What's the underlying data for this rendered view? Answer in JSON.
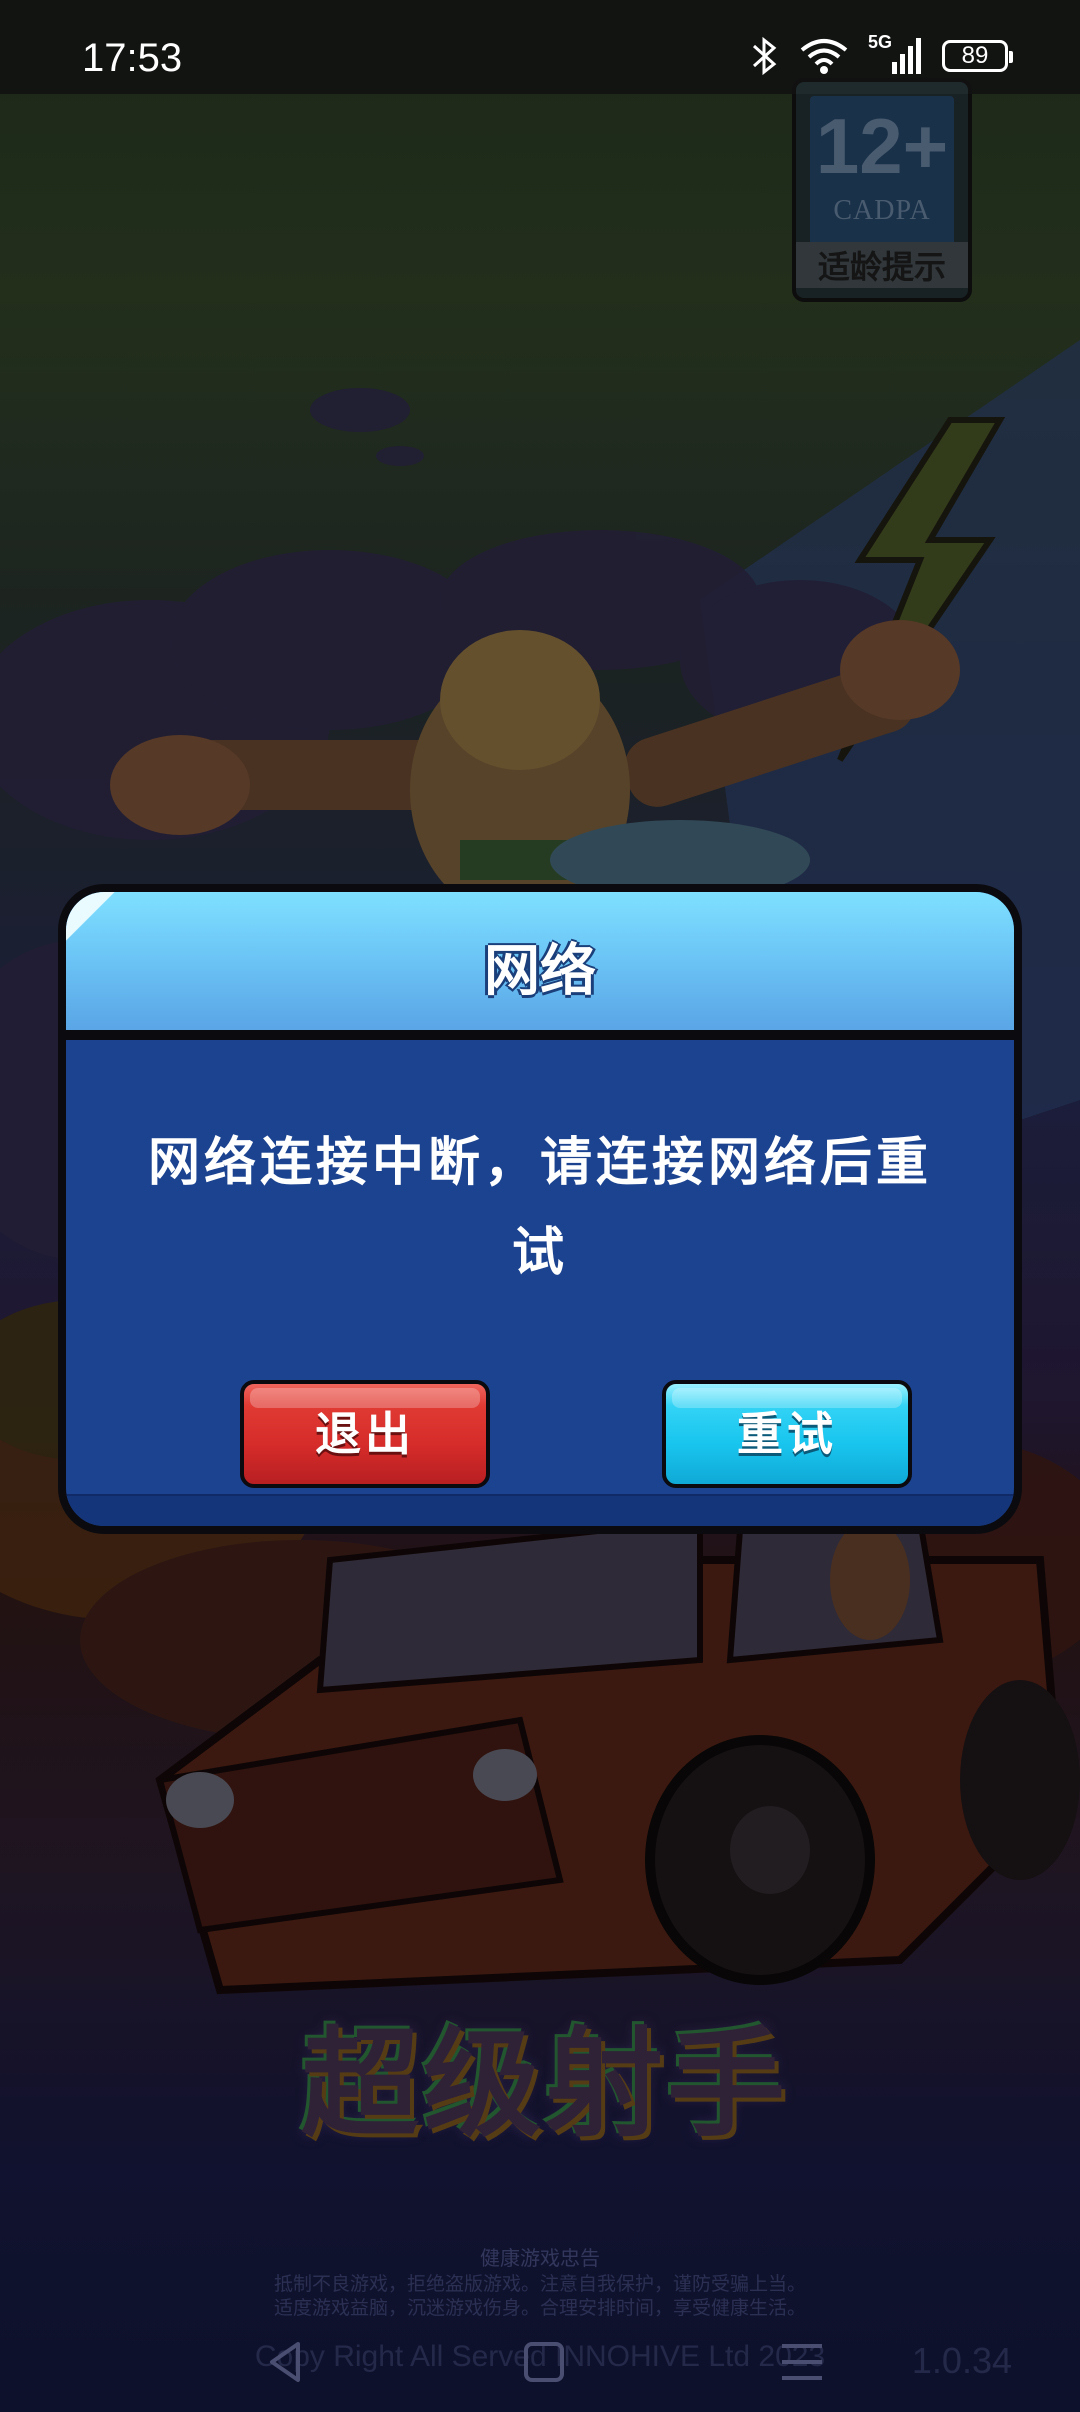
{
  "status_bar": {
    "time": "17:53",
    "network": "5G",
    "battery": "89"
  },
  "age_rating": {
    "age": "12+",
    "org": "CADPA",
    "label": "适龄提示"
  },
  "dialog": {
    "title": "网络",
    "message": "网络连接中断，请连接网络后重试",
    "exit_label": "退出",
    "retry_label": "重试"
  },
  "game": {
    "logo": "超级射手"
  },
  "footer": {
    "health_title": "健康游戏忠告",
    "warning_line1": "抵制不良游戏，拒绝盗版游戏。注意自我保护，谨防受骗上当。",
    "warning_line2": "适度游戏益脑，沉迷游戏伤身。合理安排时间，享受健康生活。",
    "copyright": "Copy Right All Served INNOHIVE Ltd 2023",
    "version": "1.0.34"
  },
  "nav_bar": {
    "back_icon": "back-triangle-icon",
    "home_icon": "home-square-icon",
    "menu_icon": "menu-lines-icon"
  },
  "colors": {
    "dialog_body": "#1b4390",
    "dialog_header": "#6cc6f6",
    "exit_button": "#d62c2a",
    "retry_button": "#18c5ee"
  }
}
